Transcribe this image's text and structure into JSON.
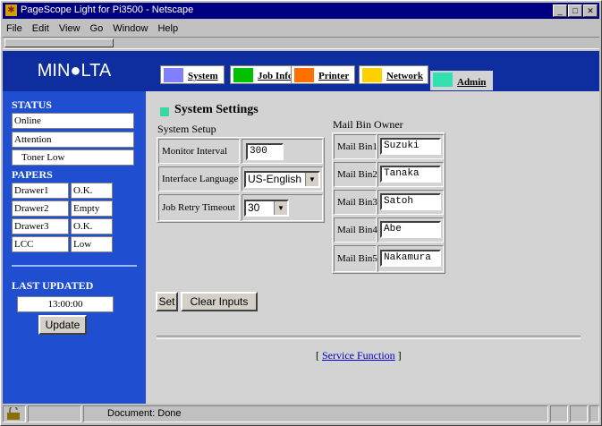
{
  "window": {
    "title": "PageScope Light for Pi3500 - Netscape"
  },
  "menu": [
    "File",
    "Edit",
    "View",
    "Go",
    "Window",
    "Help"
  ],
  "brand": "MIN●LTA",
  "tabs": [
    {
      "label": "System",
      "color": "#8080ff"
    },
    {
      "label": "Job Info",
      "color": "#00c000"
    },
    {
      "label": "Printer",
      "color": "#ff7000"
    },
    {
      "label": "Network",
      "color": "#ffd000"
    },
    {
      "label": "Admin",
      "color": "#33e0b0"
    }
  ],
  "sidebar": {
    "status_heading": "STATUS",
    "status_items": [
      "Online",
      "Attention",
      "Toner Low"
    ],
    "papers_heading": "PAPERS",
    "papers": [
      {
        "name": "Drawer1",
        "state": "O.K."
      },
      {
        "name": "Drawer2",
        "state": "Empty"
      },
      {
        "name": "Drawer3",
        "state": "O.K."
      },
      {
        "name": "LCC",
        "state": "Low"
      }
    ],
    "last_updated_heading": "LAST UPDATED",
    "time": "13:00:00",
    "update_button": "Update"
  },
  "main": {
    "section_title": "System Settings",
    "system_setup_label": "System Setup",
    "fields": {
      "monitor_interval_label": "Monitor Interval",
      "monitor_interval_value": "300",
      "interface_language_label": "Interface Language",
      "interface_language_value": "US-English",
      "job_retry_timeout_label": "Job Retry Timeout",
      "job_retry_timeout_value": "30"
    },
    "mail_bin_owner_label": "Mail Bin Owner",
    "mail_bins": [
      {
        "label": "Mail Bin1",
        "value": "Suzuki"
      },
      {
        "label": "Mail Bin2",
        "value": "Tanaka"
      },
      {
        "label": "Mail Bin3",
        "value": "Satoh"
      },
      {
        "label": "Mail Bin4",
        "value": "Abe"
      },
      {
        "label": "Mail Bin5",
        "value": "Nakamura"
      }
    ],
    "set_button": "Set",
    "clear_button": "Clear Inputs",
    "service_prefix": "[",
    "service_link": "Service Function",
    "service_suffix": "]"
  },
  "statusbar": {
    "text": "Document: Done"
  }
}
